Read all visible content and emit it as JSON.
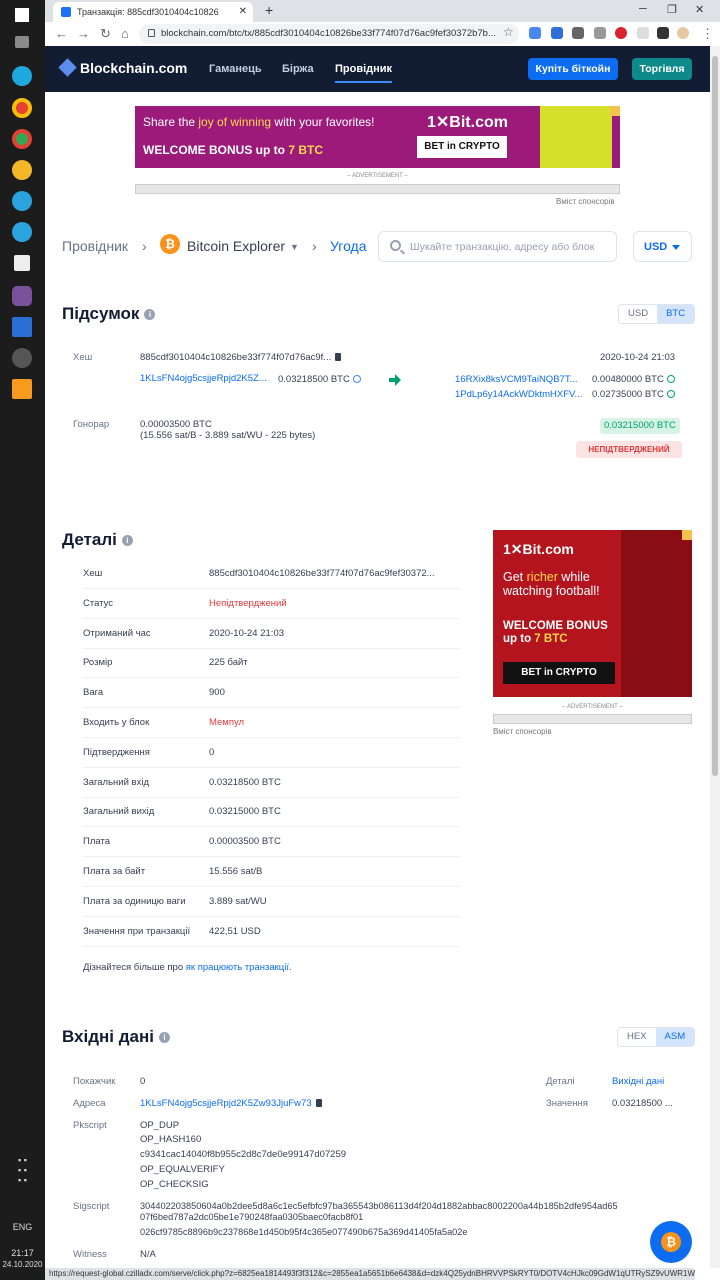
{
  "taskbar": {
    "time": "21:17",
    "date": "24.10.2020",
    "lang": "ENG"
  },
  "browser": {
    "tab_title": "Транзакція: 885cdf3010404c10826",
    "url": "blockchain.com/btc/tx/885cdf3010404c10826be33f774f07d76ac9fef30372b7b...",
    "status_url": "https://request-global.czilladx.com/serve/click.php?z=6825ea1814493f3f312&c=2855ea1a5651b6e6438&d=dzk4Q25ydnBHRVVPSkRYT0/DOTV4cHJkc09GdW1qUTRySZ9vUWR1WU..."
  },
  "header": {
    "logo": "Blockchain.com",
    "nav": [
      "Гаманець",
      "Біржа",
      "Провідник"
    ],
    "buy_label": "Купіть біткойн",
    "trade_label": "Торгівля"
  },
  "ad_top": {
    "line1_pre": "Share the ",
    "line1_em": "joy of winning",
    "line1_post": " with your favorites!",
    "line2_pre": "WELCOME BONUS up to ",
    "line2_em": "7 BTC",
    "brand": "1✕Bit.com",
    "cta": "BET in CRYPTO",
    "label": "– ADVERTISEMENT –",
    "sponsor": "Вміст спонсорів"
  },
  "breadcrumb": {
    "root": "Провідник",
    "explorer": "Bitcoin Explorer",
    "current": "Угода"
  },
  "search": {
    "placeholder": "Шукайте транзакцію, адресу або блок"
  },
  "currency": "USD",
  "summary": {
    "title": "Підсумок",
    "toggle": [
      "USD",
      "BTC"
    ],
    "hash_label": "Хеш",
    "hash": "885cdf3010404c10826be33f774f07d76ac9f...",
    "time": "2020-10-24 21:03",
    "input_addr": "1KLsFN4ojg5csjjeRpjd2K5Z...",
    "input_amount": "0.03218500 BTC",
    "outputs": [
      {
        "addr": "16RXix8ksVCM9TaiNQB7T...",
        "amount": "0.00480000 BTC"
      },
      {
        "addr": "1PdLp6y14AckWDktmHXFV...",
        "amount": "0.02735000 BTC"
      }
    ],
    "fee_label": "Гонорар",
    "fee": "0.00003500 BTC",
    "fee_detail": "(15.556 sat/B - 3.889 sat/WU - 225 bytes)",
    "total_out": "0.03215000 BTC",
    "status": "НЕПІДТВЕРДЖЕНИЙ"
  },
  "details": {
    "title": "Деталі",
    "rows": [
      {
        "k": "Хеш",
        "v": "885cdf3010404c10826be33f774f07d76ac9fef30372..."
      },
      {
        "k": "Статус",
        "v": "Непідтверджений"
      },
      {
        "k": "Отриманий час",
        "v": "2020-10-24 21:03"
      },
      {
        "k": "Розмір",
        "v": "225 байт"
      },
      {
        "k": "Вага",
        "v": "900"
      },
      {
        "k": "Входить у блок",
        "v": "Мемпул"
      },
      {
        "k": "Підтвердження",
        "v": "0"
      },
      {
        "k": "Загальний вхід",
        "v": "0.03218500 BTC"
      },
      {
        "k": "Загальний вихід",
        "v": "0.03215000 BTC"
      },
      {
        "k": "Плата",
        "v": "0.00003500 BTC"
      },
      {
        "k": "Плата за байт",
        "v": "15.556 sat/B"
      },
      {
        "k": "Плата за одиницю ваги",
        "v": "3.889 sat/WU"
      },
      {
        "k": "Значення при транзакції",
        "v": "422,51 USD"
      }
    ],
    "learn_pre": "Дізнайтеся більше про ",
    "learn_link": "як працюють транзакції."
  },
  "ad_side": {
    "brand": "1✕Bit.com",
    "t1_pre": "Get ",
    "t1_em": "richer",
    "t1_post": " while watching football!",
    "t2_pre": "WELCOME BONUS up to ",
    "t2_em": "7 BTC",
    "cta": "BET in CRYPTO",
    "label": "– ADVERTISEMENT –",
    "sponsor": "Вміст спонсорів"
  },
  "inputs": {
    "title": "Вхідні дані",
    "toggle": [
      "HEX",
      "ASM"
    ],
    "index_label": "Покажчик",
    "index": "0",
    "details_label": "Деталі",
    "details_value": "Вихідні дані",
    "address_label": "Адреса",
    "address": "1KLsFN4ojg5csjjeRpjd2K5Zw93JjuFw73",
    "value_label": "Значення",
    "value": "0.03218500 ...",
    "pkscript_label": "Pkscript",
    "pkscript": [
      "OP_DUP",
      "OP_HASH160",
      "c9341cac14040f8b955c2d8c7de0e99147d07259",
      "OP_EQUALVERIFY",
      "OP_CHECKSIG"
    ],
    "sigscript_label": "Sigscript",
    "sigscript": [
      "304402203850604a0b2dee5d8a6c1ec5efbfc97ba365543b086113d4f204d1882abbac8002200a44b185b2dfe954ad65",
      "07f6bed787a2dc05be1e790248faa0305baec0facb8f01",
      "026cf9785c8896b9c237868e1d450b95f4c365e077490b675a369d41405fa5a02e"
    ],
    "witness_label": "Witness",
    "witness": "N/A"
  },
  "colors": {
    "header_bg": "#121d33",
    "accent": "#0c6cf2",
    "danger": "#de3a3a",
    "success": "#00a171"
  }
}
